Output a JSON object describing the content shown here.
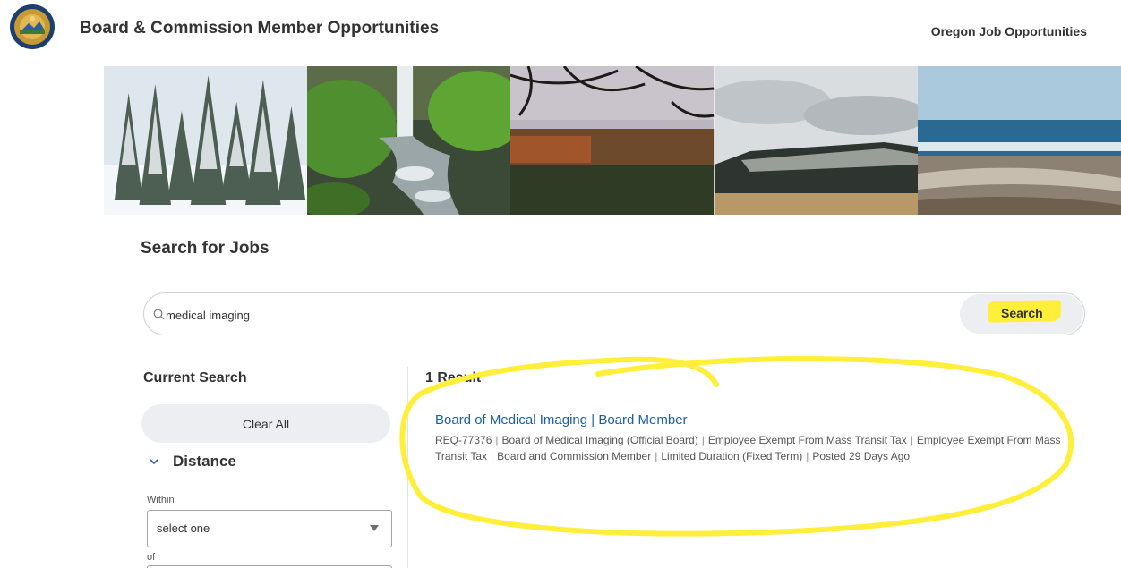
{
  "header": {
    "title": "Board & Commission Member Opportunities",
    "right_link": "Oregon Job Opportunities"
  },
  "search": {
    "heading": "Search for Jobs",
    "query": "medical imaging",
    "button_label": "Search"
  },
  "sidebar": {
    "heading": "Current Search",
    "clear_all_label": "Clear All",
    "distance": {
      "label": "Distance",
      "within_label": "Within",
      "select_value": "select one",
      "of_label": "of"
    }
  },
  "results": {
    "count_label": "1 Result",
    "items": [
      {
        "title": "Board of Medical Imaging | Board Member",
        "meta": [
          "REQ-77376",
          "Board of Medical Imaging (Official Board)",
          "Employee Exempt From Mass Transit Tax",
          "Employee Exempt From Mass Transit Tax",
          "Board and Commission Member",
          "Limited Duration (Fixed Term)",
          "Posted 29 Days Ago"
        ]
      }
    ]
  },
  "colors": {
    "highlight": "#ffef3a",
    "link": "#1a5ea8",
    "button_bg": "#eceef1"
  }
}
